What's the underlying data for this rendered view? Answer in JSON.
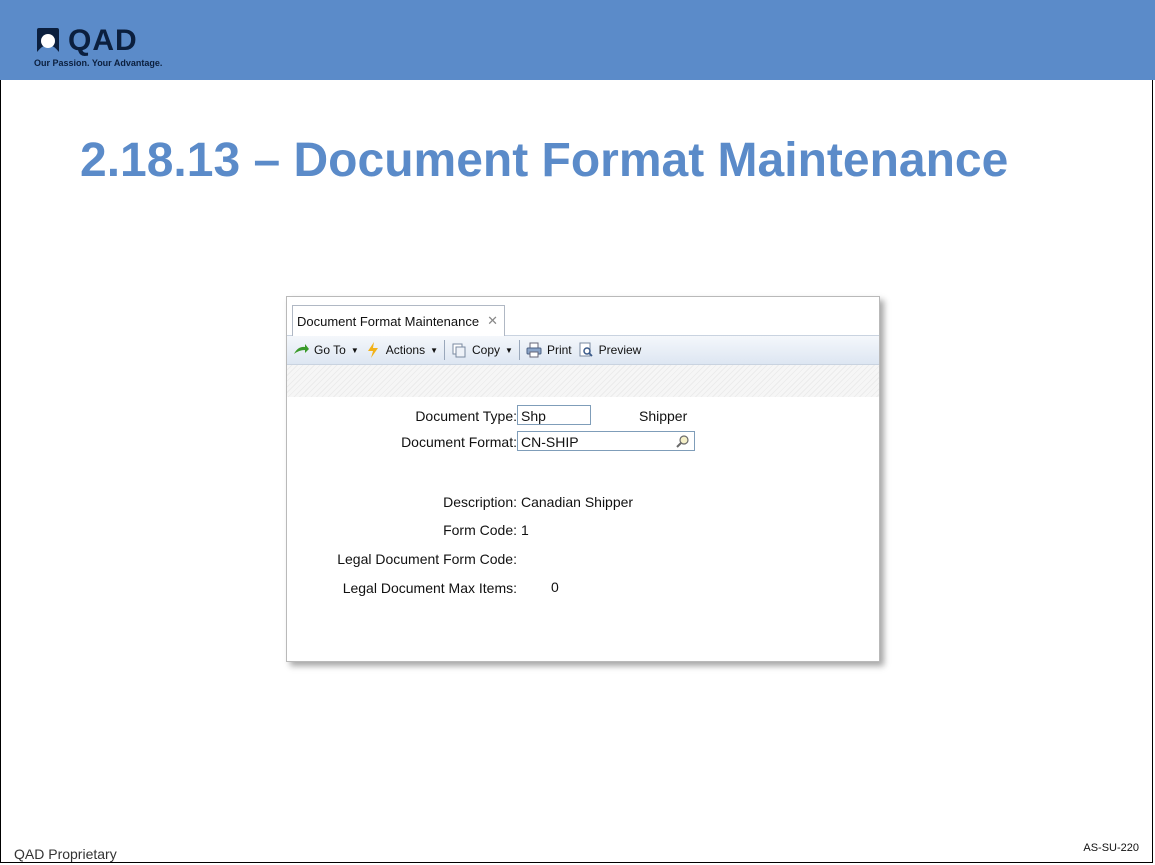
{
  "slide": {
    "brand": "QAD",
    "tagline": "Our Passion. Your Advantage.",
    "title": "2.18.13 – Document Format Maintenance",
    "footer_left": "QAD Proprietary",
    "footer_right": "AS-SU-220",
    "colors": {
      "band": "#5b8bc9",
      "title": "#5b8bc9"
    }
  },
  "app": {
    "tab_label": "Document Format Maintenance",
    "toolbar": {
      "goto_label": "Go To",
      "actions_label": "Actions",
      "copy_label": "Copy",
      "print_label": "Print",
      "preview_label": "Preview"
    },
    "form": {
      "doc_type_label": "Document Type:",
      "doc_type_value": "Shp",
      "doc_type_desc": "Shipper",
      "doc_format_label": "Document Format:",
      "doc_format_value": "CN-SHIP",
      "description_label": "Description:",
      "description_value": "Canadian Shipper",
      "form_code_label": "Form Code:",
      "form_code_value": "1",
      "legal_form_code_label": "Legal Document Form Code:",
      "legal_form_code_value": "",
      "legal_max_items_label": "Legal Document Max Items:",
      "legal_max_items_value": "0"
    }
  }
}
